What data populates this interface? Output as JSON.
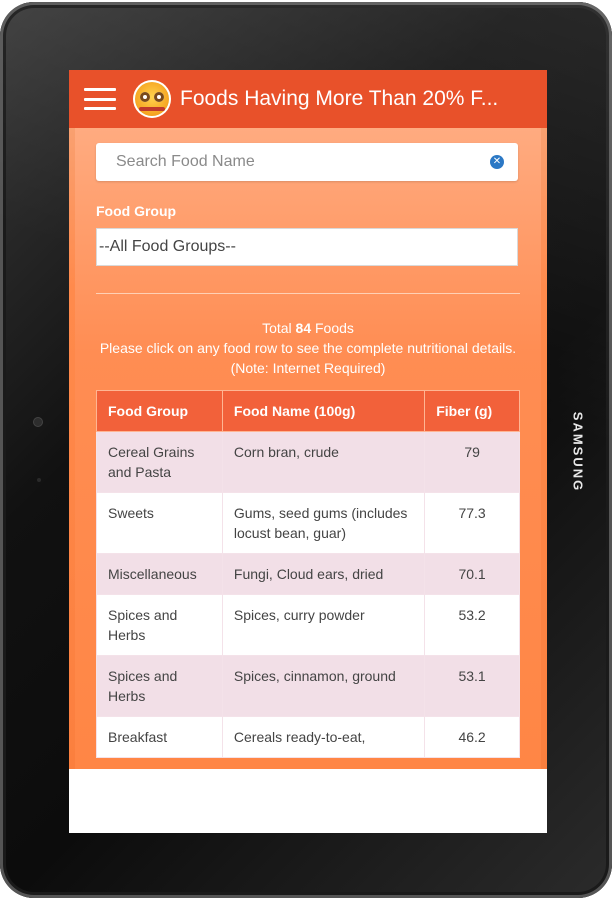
{
  "device": {
    "brand": "SAMSUNG"
  },
  "appbar": {
    "title": "Foods Having More Than 20% F...",
    "menu_icon": "hamburger-menu-icon",
    "logo_icon": "app-logo-icon"
  },
  "search": {
    "placeholder": "Search Food Name",
    "value": "",
    "clear_icon": "clear-search-icon"
  },
  "filter": {
    "label": "Food Group",
    "selected": "--All Food Groups--"
  },
  "summary": {
    "total_prefix": "Total",
    "total_count": "84",
    "total_suffix": "Foods",
    "note": "Please click on any food row to see the complete nutritional details. (Note: Internet Required)"
  },
  "table": {
    "headers": [
      "Food Group",
      "Food Name (100g)",
      "Fiber (g)"
    ],
    "rows": [
      {
        "group": "Cereal Grains and Pasta",
        "name": "Corn bran, crude",
        "fiber": "79"
      },
      {
        "group": "Sweets",
        "name": "Gums, seed gums (includes locust bean, guar)",
        "fiber": "77.3"
      },
      {
        "group": "Miscellaneous",
        "name": "Fungi, Cloud ears, dried",
        "fiber": "70.1"
      },
      {
        "group": "Spices and Herbs",
        "name": "Spices, curry powder",
        "fiber": "53.2"
      },
      {
        "group": "Spices and Herbs",
        "name": "Spices, cinnamon, ground",
        "fiber": "53.1"
      },
      {
        "group": "Breakfast",
        "name": "Cereals ready-to-eat,",
        "fiber": "46.2"
      }
    ]
  },
  "colors": {
    "appbar": "#e8512a",
    "content": "#ff8d53",
    "table_header": "#f2613a",
    "row_alt": "#f2dfe7"
  }
}
